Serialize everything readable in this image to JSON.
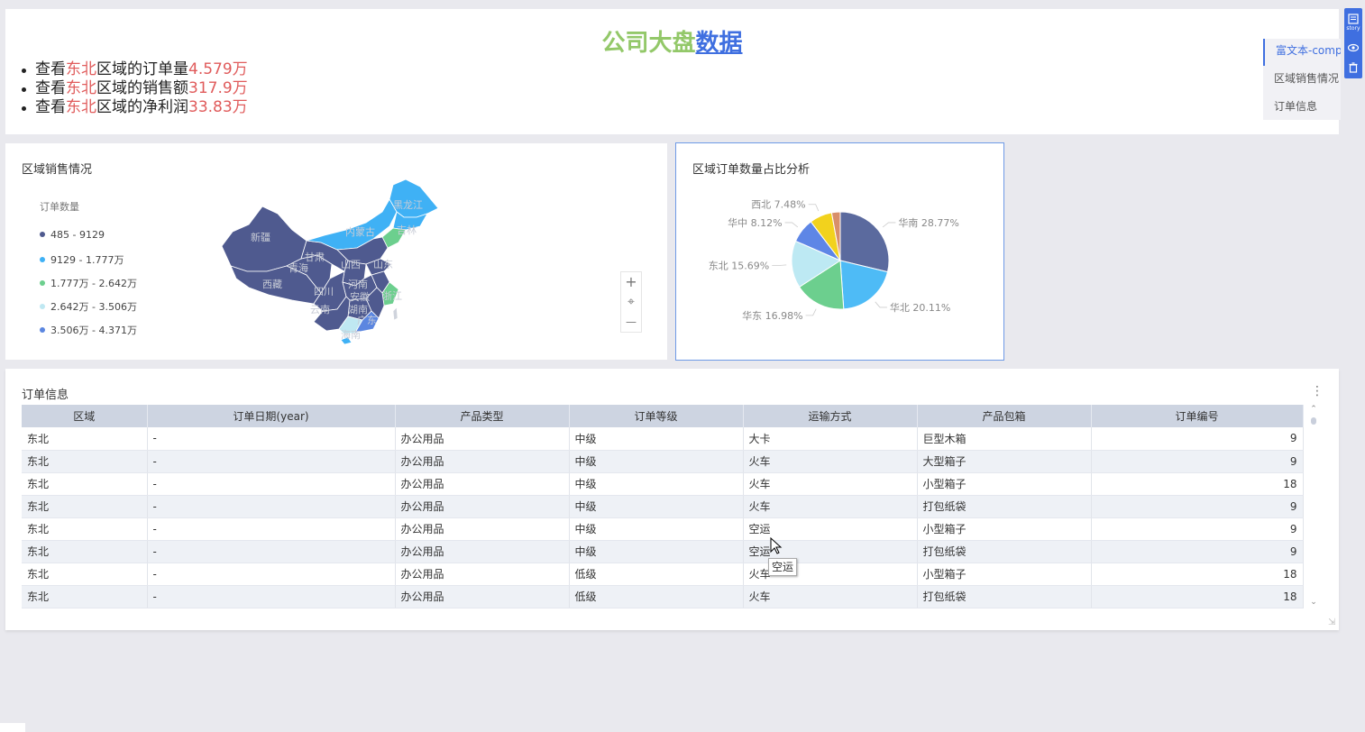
{
  "story_bar": {
    "label": "story",
    "icons": [
      "story-icon",
      "eye-icon",
      "trash-icon"
    ]
  },
  "rich_text": {
    "title_part1": "公司大盘",
    "title_part2": "数据",
    "lines": [
      {
        "p1": "查看",
        "region": "东北",
        "p2": "区域的订单量",
        "value": "4.579万"
      },
      {
        "p1": "查看",
        "region": "东北",
        "p2": "区域的销售额",
        "value": "317.9万"
      },
      {
        "p1": "查看",
        "region": "东北",
        "p2": "区域的净利润",
        "value": "33.83万"
      }
    ]
  },
  "anchor_nav": {
    "items": [
      "富文本-comp",
      "区域销售情况",
      "订单信息"
    ],
    "active_index": 0
  },
  "map_card": {
    "title": "区域销售情况",
    "legend_title": "订单数量",
    "legend": [
      {
        "label": "485 - 9129",
        "color": "#4f5a8f"
      },
      {
        "label": "9129 - 1.777万",
        "color": "#3fb1f5"
      },
      {
        "label": "1.777万 - 2.642万",
        "color": "#6ccf8e"
      },
      {
        "label": "2.642万 - 3.506万",
        "color": "#bfe8f2"
      },
      {
        "label": "3.506万 - 4.371万",
        "color": "#5b86e0"
      }
    ],
    "province_labels": [
      "黑龙江",
      "内蒙古",
      "吉林",
      "新疆",
      "甘肃",
      "青海",
      "山西",
      "山东",
      "西藏",
      "四川",
      "浙江",
      "湖南",
      "云南",
      "广东",
      "海南",
      "河南",
      "安徽"
    ],
    "zoom": {
      "plus": "+",
      "locate": "⌖",
      "minus": "—"
    }
  },
  "pie_card": {
    "title": "区域订单数量占比分析",
    "chart_data": {
      "type": "pie",
      "slices": [
        {
          "name": "华南",
          "value": 28.77,
          "label": "华南 28.77%",
          "color": "#5b6a9e"
        },
        {
          "name": "华北",
          "value": 20.11,
          "label": "华北 20.11%",
          "color": "#4ebbf6"
        },
        {
          "name": "华东",
          "value": 16.98,
          "label": "华东 16.98%",
          "color": "#6ccf8e"
        },
        {
          "name": "东北",
          "value": 15.69,
          "label": "东北 15.69%",
          "color": "#bde9f3"
        },
        {
          "name": "华中",
          "value": 8.12,
          "label": "华中 8.12%",
          "color": "#5e86e6"
        },
        {
          "name": "西北",
          "value": 7.48,
          "label": "西北 7.48%",
          "color": "#f2d21d"
        },
        {
          "name": "西南",
          "value": 2.85,
          "label": "",
          "color": "#d88f6a"
        }
      ]
    }
  },
  "table_card": {
    "title": "订单信息",
    "columns": [
      "区域",
      "订单日期(year)",
      "产品类型",
      "订单等级",
      "运输方式",
      "产品包箱",
      "订单编号"
    ],
    "rows": [
      [
        "东北",
        "-",
        "办公用品",
        "中级",
        "大卡",
        "巨型木箱",
        "9"
      ],
      [
        "东北",
        "-",
        "办公用品",
        "中级",
        "火车",
        "大型箱子",
        "9"
      ],
      [
        "东北",
        "-",
        "办公用品",
        "中级",
        "火车",
        "小型箱子",
        "18"
      ],
      [
        "东北",
        "-",
        "办公用品",
        "中级",
        "火车",
        "打包纸袋",
        "9"
      ],
      [
        "东北",
        "-",
        "办公用品",
        "中级",
        "空运",
        "小型箱子",
        "9"
      ],
      [
        "东北",
        "-",
        "办公用品",
        "中级",
        "空运",
        "打包纸袋",
        "9"
      ],
      [
        "东北",
        "-",
        "办公用品",
        "低级",
        "火车",
        "小型箱子",
        "18"
      ],
      [
        "东北",
        "-",
        "办公用品",
        "低级",
        "火车",
        "打包纸袋",
        "18"
      ]
    ],
    "tooltip": "空运"
  }
}
